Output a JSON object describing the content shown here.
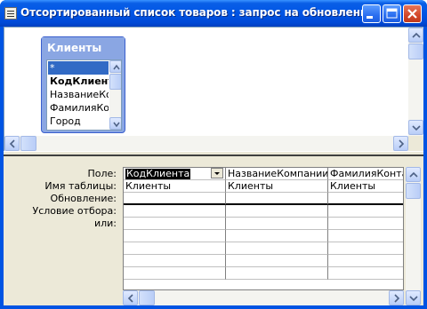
{
  "window": {
    "title": "Отсортированный список товаров : запрос на обновление"
  },
  "table_box": {
    "title": "Клиенты",
    "fields": [
      "*",
      "КодКлиента",
      "НазваниеКомпании",
      "ФамилияКонтакта",
      "Город"
    ]
  },
  "grid": {
    "row_labels": [
      "Поле:",
      "Имя таблицы:",
      "Обновление:",
      "Условие отбора:",
      "или:"
    ],
    "columns": [
      {
        "field": "КодКлиента",
        "table": "Клиенты"
      },
      {
        "field": "НазваниеКомпании",
        "table": "Клиенты"
      },
      {
        "field": "ФамилияКонтакта",
        "table": "Клиенты"
      }
    ]
  },
  "icons": {
    "minimize": "minimize-icon",
    "maximize": "maximize-icon",
    "close": "close-icon",
    "app": "query-window-icon"
  }
}
